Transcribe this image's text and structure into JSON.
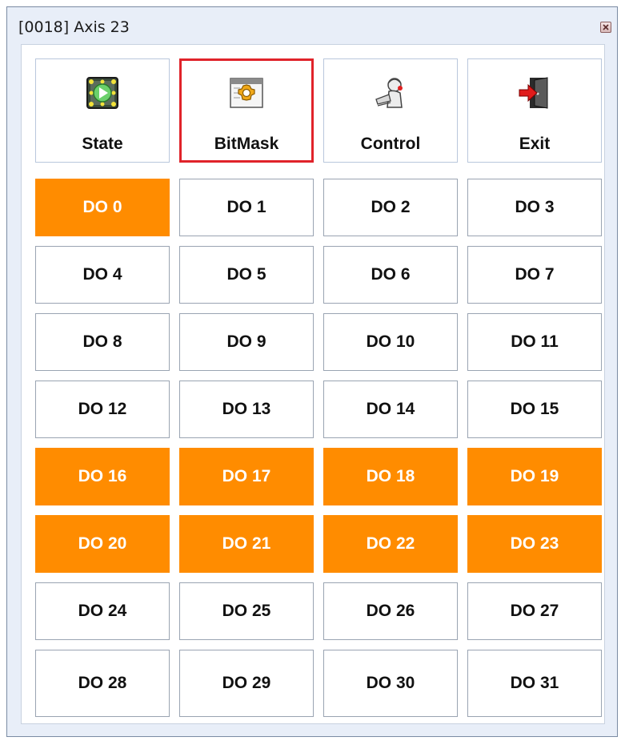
{
  "window": {
    "title": "[0018] Axis 23"
  },
  "toolbar": {
    "buttons": [
      {
        "label": "State",
        "icon": "state-play-icon"
      },
      {
        "label": "BitMask",
        "icon": "bitmask-gear-icon",
        "selected": true
      },
      {
        "label": "Control",
        "icon": "control-operator-icon"
      },
      {
        "label": "Exit",
        "icon": "exit-door-icon"
      }
    ]
  },
  "colors": {
    "active": "#ff8c00",
    "selected_border": "#e0232a"
  },
  "outputs": [
    {
      "label": "DO 0",
      "on": true
    },
    {
      "label": "DO 1",
      "on": false
    },
    {
      "label": "DO 2",
      "on": false
    },
    {
      "label": "DO 3",
      "on": false
    },
    {
      "label": "DO 4",
      "on": false
    },
    {
      "label": "DO 5",
      "on": false
    },
    {
      "label": "DO 6",
      "on": false
    },
    {
      "label": "DO 7",
      "on": false
    },
    {
      "label": "DO 8",
      "on": false
    },
    {
      "label": "DO 9",
      "on": false
    },
    {
      "label": "DO 10",
      "on": false
    },
    {
      "label": "DO 11",
      "on": false
    },
    {
      "label": "DO 12",
      "on": false
    },
    {
      "label": "DO 13",
      "on": false
    },
    {
      "label": "DO 14",
      "on": false
    },
    {
      "label": "DO 15",
      "on": false
    },
    {
      "label": "DO 16",
      "on": true
    },
    {
      "label": "DO 17",
      "on": true
    },
    {
      "label": "DO 18",
      "on": true
    },
    {
      "label": "DO 19",
      "on": true
    },
    {
      "label": "DO 20",
      "on": true
    },
    {
      "label": "DO 21",
      "on": true
    },
    {
      "label": "DO 22",
      "on": true
    },
    {
      "label": "DO 23",
      "on": true
    },
    {
      "label": "DO 24",
      "on": false
    },
    {
      "label": "DO 25",
      "on": false
    },
    {
      "label": "DO 26",
      "on": false
    },
    {
      "label": "DO 27",
      "on": false
    },
    {
      "label": "DO 28",
      "on": false
    },
    {
      "label": "DO 29",
      "on": false
    },
    {
      "label": "DO 30",
      "on": false
    },
    {
      "label": "DO 31",
      "on": false
    }
  ]
}
